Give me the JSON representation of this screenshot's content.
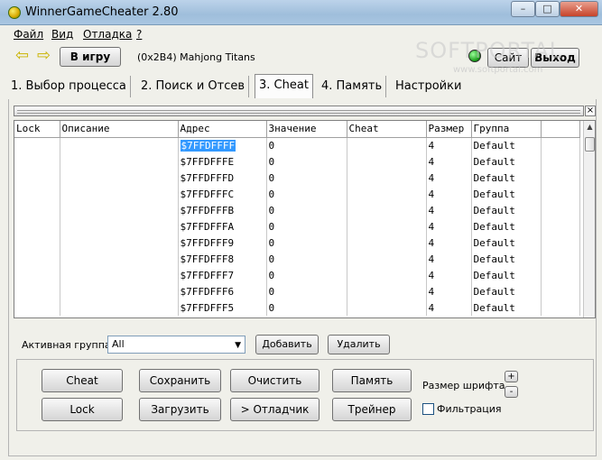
{
  "window": {
    "title": "WinnerGameCheater 2.80",
    "min_label": "–",
    "max_label": "□",
    "close_label": "✕"
  },
  "menu": [
    "Файл",
    "Вид",
    "Отладка",
    "?"
  ],
  "toolbar": {
    "back_arrow": "⇦",
    "forward_arrow": "⇨",
    "game_button": "В игру",
    "process": "(0x2B4) Mahjong Titans",
    "site_button": "Сайт",
    "exit_button": "Выход"
  },
  "watermark": {
    "brand": "SOFTPORTAL",
    "url": "www.softportal.com"
  },
  "tabs": [
    {
      "label": "1. Выбор процесса",
      "active": false
    },
    {
      "label": "2. Поиск и Отсев",
      "active": false
    },
    {
      "label": "3. Cheat",
      "active": true
    },
    {
      "label": "4. Память",
      "active": false
    },
    {
      "label": "Настройки",
      "active": false
    }
  ],
  "table": {
    "columns": [
      "Lock",
      "Описание",
      "Адрес",
      "Значение",
      "Cheat",
      "Размер",
      "Группа"
    ],
    "rows": [
      {
        "lock": "",
        "desc": "",
        "addr": "$7FFDFFFF",
        "value": "0",
        "cheat": "",
        "size": "4",
        "group": "Default",
        "selected": true
      },
      {
        "lock": "",
        "desc": "",
        "addr": "$7FFDFFFE",
        "value": "0",
        "cheat": "",
        "size": "4",
        "group": "Default"
      },
      {
        "lock": "",
        "desc": "",
        "addr": "$7FFDFFFD",
        "value": "0",
        "cheat": "",
        "size": "4",
        "group": "Default"
      },
      {
        "lock": "",
        "desc": "",
        "addr": "$7FFDFFFC",
        "value": "0",
        "cheat": "",
        "size": "4",
        "group": "Default"
      },
      {
        "lock": "",
        "desc": "",
        "addr": "$7FFDFFFB",
        "value": "0",
        "cheat": "",
        "size": "4",
        "group": "Default"
      },
      {
        "lock": "",
        "desc": "",
        "addr": "$7FFDFFFA",
        "value": "0",
        "cheat": "",
        "size": "4",
        "group": "Default"
      },
      {
        "lock": "",
        "desc": "",
        "addr": "$7FFDFFF9",
        "value": "0",
        "cheat": "",
        "size": "4",
        "group": "Default"
      },
      {
        "lock": "",
        "desc": "",
        "addr": "$7FFDFFF8",
        "value": "0",
        "cheat": "",
        "size": "4",
        "group": "Default"
      },
      {
        "lock": "",
        "desc": "",
        "addr": "$7FFDFFF7",
        "value": "0",
        "cheat": "",
        "size": "4",
        "group": "Default"
      },
      {
        "lock": "",
        "desc": "",
        "addr": "$7FFDFFF6",
        "value": "0",
        "cheat": "",
        "size": "4",
        "group": "Default"
      },
      {
        "lock": "",
        "desc": "",
        "addr": "$7FFDFFF5",
        "value": "0",
        "cheat": "",
        "size": "4",
        "group": "Default"
      }
    ]
  },
  "group_bar": {
    "label": "Активная группа:",
    "selected": "All",
    "add_button": "Добавить",
    "delete_button": "Удалить"
  },
  "actions": {
    "cheat": "Cheat",
    "lock": "Lock",
    "save": "Сохранить",
    "load": "Загрузить",
    "clear": "Очистить",
    "debugger": "> Отладчик",
    "memory": "Память",
    "trainer": "Трейнер",
    "font_size_label": "Размер шрифта",
    "font_plus": "+",
    "font_minus": "-",
    "filter_label": "Фильтрация"
  },
  "colors": {
    "selection": "#3399ff",
    "titlebar": "#a9c6e2",
    "status_led": "#1b9d1b"
  },
  "icons": {
    "app": "app-icon",
    "back": "arrow-left-icon",
    "forward": "arrow-right-icon",
    "status": "status-led-icon",
    "dropdown": "chevron-down-icon"
  }
}
